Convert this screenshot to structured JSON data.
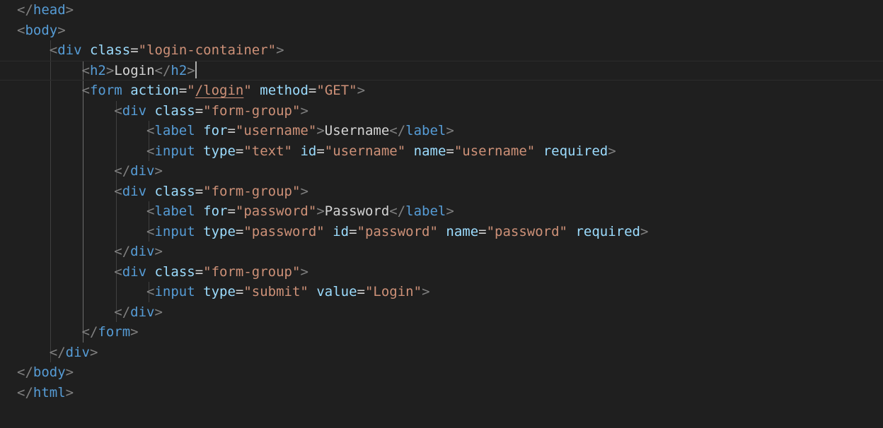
{
  "editor": {
    "colors": {
      "background": "#1f1f1f",
      "bracket": "#808080",
      "tag": "#569cd6",
      "attribute": "#9cdcfe",
      "string": "#ce9178",
      "text": "#d4d4d4"
    },
    "lines": [
      {
        "indent": 0,
        "tokens": [
          [
            "bracket",
            "</"
          ],
          [
            "tag",
            "head"
          ],
          [
            "bracket",
            ">"
          ]
        ]
      },
      {
        "indent": 0,
        "tokens": [
          [
            "bracket",
            "<"
          ],
          [
            "tag",
            "body"
          ],
          [
            "bracket",
            ">"
          ]
        ]
      },
      {
        "indent": 1,
        "tokens": [
          [
            "bracket",
            "<"
          ],
          [
            "tag",
            "div"
          ],
          [
            "text",
            " "
          ],
          [
            "attr",
            "class"
          ],
          [
            "eq",
            "="
          ],
          [
            "str",
            "\"login-container\""
          ],
          [
            "bracket",
            ">"
          ]
        ]
      },
      {
        "indent": 2,
        "current": true,
        "cursor": true,
        "tokens": [
          [
            "bracket",
            "<"
          ],
          [
            "tag",
            "h2"
          ],
          [
            "bracket",
            ">"
          ],
          [
            "text",
            "Login"
          ],
          [
            "bracket",
            "</"
          ],
          [
            "tag",
            "h2"
          ],
          [
            "bracket",
            ">"
          ]
        ]
      },
      {
        "indent": 2,
        "tokens": [
          [
            "bracket",
            "<"
          ],
          [
            "tag",
            "form"
          ],
          [
            "text",
            " "
          ],
          [
            "attr",
            "action"
          ],
          [
            "eq",
            "="
          ],
          [
            "str",
            "\""
          ],
          [
            "link",
            "/login"
          ],
          [
            "str",
            "\""
          ],
          [
            "text",
            " "
          ],
          [
            "attr",
            "method"
          ],
          [
            "eq",
            "="
          ],
          [
            "str",
            "\"GET\""
          ],
          [
            "bracket",
            ">"
          ]
        ]
      },
      {
        "indent": 3,
        "tokens": [
          [
            "bracket",
            "<"
          ],
          [
            "tag",
            "div"
          ],
          [
            "text",
            " "
          ],
          [
            "attr",
            "class"
          ],
          [
            "eq",
            "="
          ],
          [
            "str",
            "\"form-group\""
          ],
          [
            "bracket",
            ">"
          ]
        ]
      },
      {
        "indent": 4,
        "tokens": [
          [
            "bracket",
            "<"
          ],
          [
            "tag",
            "label"
          ],
          [
            "text",
            " "
          ],
          [
            "attr",
            "for"
          ],
          [
            "eq",
            "="
          ],
          [
            "str",
            "\"username\""
          ],
          [
            "bracket",
            ">"
          ],
          [
            "text",
            "Username"
          ],
          [
            "bracket",
            "</"
          ],
          [
            "tag",
            "label"
          ],
          [
            "bracket",
            ">"
          ]
        ]
      },
      {
        "indent": 4,
        "tokens": [
          [
            "bracket",
            "<"
          ],
          [
            "tag",
            "input"
          ],
          [
            "text",
            " "
          ],
          [
            "attr",
            "type"
          ],
          [
            "eq",
            "="
          ],
          [
            "str",
            "\"text\""
          ],
          [
            "text",
            " "
          ],
          [
            "attr",
            "id"
          ],
          [
            "eq",
            "="
          ],
          [
            "str",
            "\"username\""
          ],
          [
            "text",
            " "
          ],
          [
            "attr",
            "name"
          ],
          [
            "eq",
            "="
          ],
          [
            "str",
            "\"username\""
          ],
          [
            "text",
            " "
          ],
          [
            "attr",
            "required"
          ],
          [
            "bracket",
            ">"
          ]
        ]
      },
      {
        "indent": 3,
        "tokens": [
          [
            "bracket",
            "</"
          ],
          [
            "tag",
            "div"
          ],
          [
            "bracket",
            ">"
          ]
        ]
      },
      {
        "indent": 3,
        "tokens": [
          [
            "bracket",
            "<"
          ],
          [
            "tag",
            "div"
          ],
          [
            "text",
            " "
          ],
          [
            "attr",
            "class"
          ],
          [
            "eq",
            "="
          ],
          [
            "str",
            "\"form-group\""
          ],
          [
            "bracket",
            ">"
          ]
        ]
      },
      {
        "indent": 4,
        "tokens": [
          [
            "bracket",
            "<"
          ],
          [
            "tag",
            "label"
          ],
          [
            "text",
            " "
          ],
          [
            "attr",
            "for"
          ],
          [
            "eq",
            "="
          ],
          [
            "str",
            "\"password\""
          ],
          [
            "bracket",
            ">"
          ],
          [
            "text",
            "Password"
          ],
          [
            "bracket",
            "</"
          ],
          [
            "tag",
            "label"
          ],
          [
            "bracket",
            ">"
          ]
        ]
      },
      {
        "indent": 4,
        "tokens": [
          [
            "bracket",
            "<"
          ],
          [
            "tag",
            "input"
          ],
          [
            "text",
            " "
          ],
          [
            "attr",
            "type"
          ],
          [
            "eq",
            "="
          ],
          [
            "str",
            "\"password\""
          ],
          [
            "text",
            " "
          ],
          [
            "attr",
            "id"
          ],
          [
            "eq",
            "="
          ],
          [
            "str",
            "\"password\""
          ],
          [
            "text",
            " "
          ],
          [
            "attr",
            "name"
          ],
          [
            "eq",
            "="
          ],
          [
            "str",
            "\"password\""
          ],
          [
            "text",
            " "
          ],
          [
            "attr",
            "required"
          ],
          [
            "bracket",
            ">"
          ]
        ]
      },
      {
        "indent": 3,
        "tokens": [
          [
            "bracket",
            "</"
          ],
          [
            "tag",
            "div"
          ],
          [
            "bracket",
            ">"
          ]
        ]
      },
      {
        "indent": 3,
        "tokens": [
          [
            "bracket",
            "<"
          ],
          [
            "tag",
            "div"
          ],
          [
            "text",
            " "
          ],
          [
            "attr",
            "class"
          ],
          [
            "eq",
            "="
          ],
          [
            "str",
            "\"form-group\""
          ],
          [
            "bracket",
            ">"
          ]
        ]
      },
      {
        "indent": 4,
        "tokens": [
          [
            "bracket",
            "<"
          ],
          [
            "tag",
            "input"
          ],
          [
            "text",
            " "
          ],
          [
            "attr",
            "type"
          ],
          [
            "eq",
            "="
          ],
          [
            "str",
            "\"submit\""
          ],
          [
            "text",
            " "
          ],
          [
            "attr",
            "value"
          ],
          [
            "eq",
            "="
          ],
          [
            "str",
            "\"Login\""
          ],
          [
            "bracket",
            ">"
          ]
        ]
      },
      {
        "indent": 3,
        "tokens": [
          [
            "bracket",
            "</"
          ],
          [
            "tag",
            "div"
          ],
          [
            "bracket",
            ">"
          ]
        ]
      },
      {
        "indent": 2,
        "tokens": [
          [
            "bracket",
            "</"
          ],
          [
            "tag",
            "form"
          ],
          [
            "bracket",
            ">"
          ]
        ]
      },
      {
        "indent": 1,
        "tokens": [
          [
            "bracket",
            "</"
          ],
          [
            "tag",
            "div"
          ],
          [
            "bracket",
            ">"
          ]
        ]
      },
      {
        "indent": 0,
        "tokens": [
          [
            "bracket",
            "</"
          ],
          [
            "tag",
            "body"
          ],
          [
            "bracket",
            ">"
          ]
        ]
      },
      {
        "indent": 0,
        "tokens": [
          [
            "bracket",
            "</"
          ],
          [
            "tag",
            "html"
          ],
          [
            "bracket",
            ">"
          ]
        ]
      }
    ]
  }
}
